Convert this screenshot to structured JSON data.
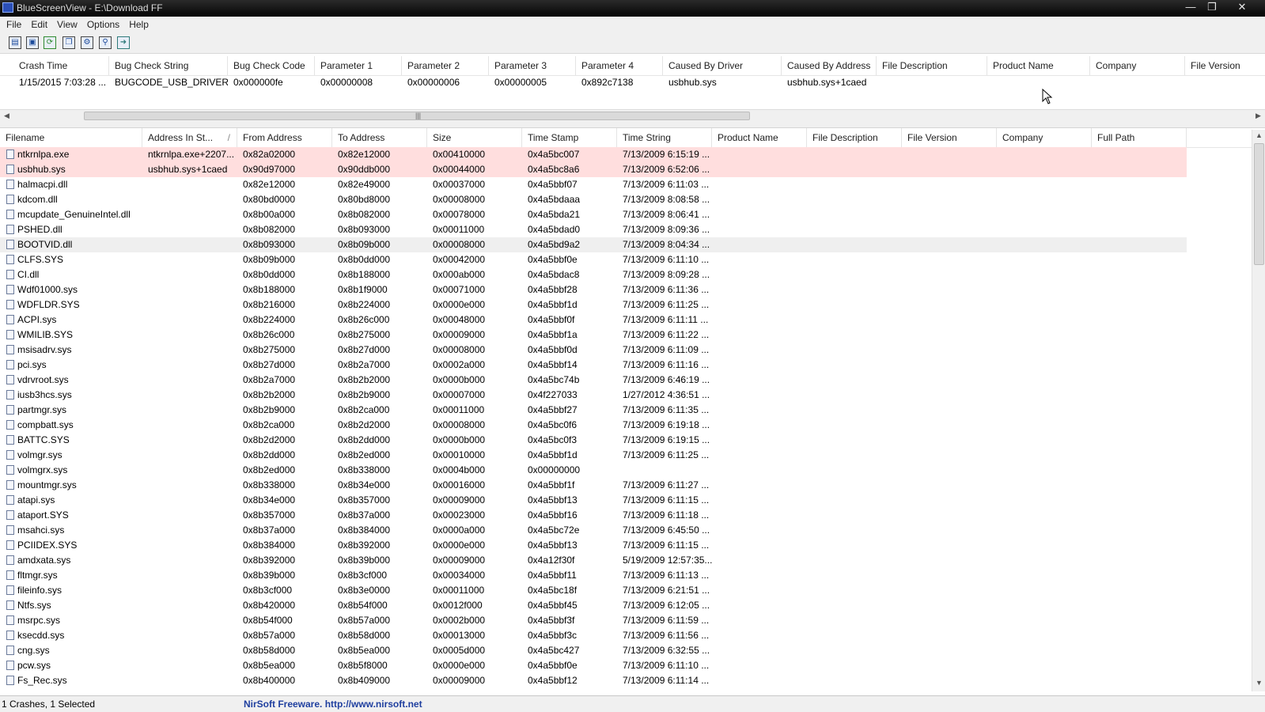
{
  "window": {
    "title": "BlueScreenView  -  E:\\Download FF"
  },
  "menu": [
    "File",
    "Edit",
    "View",
    "Options",
    "Help"
  ],
  "toolbar": [
    "properties-icon",
    "save-icon",
    "refresh-icon",
    "copy-icon",
    "advanced-options-icon",
    "find-icon",
    "exit-icon"
  ],
  "crashes": {
    "columns": [
      "Crash Time",
      "Bug Check String",
      "Bug Check Code",
      "Parameter 1",
      "Parameter 2",
      "Parameter 3",
      "Parameter 4",
      "Caused By Driver",
      "Caused By Address",
      "File Description",
      "Product Name",
      "Company",
      "File Version"
    ],
    "rows": [
      [
        "1/15/2015 7:03:28 ...",
        "BUGCODE_USB_DRIVER",
        "0x000000fe",
        "0x00000008",
        "0x00000006",
        "0x00000005",
        "0x892c7138",
        "usbhub.sys",
        "usbhub.sys+1caed",
        "",
        "",
        "",
        ""
      ]
    ]
  },
  "drivers": {
    "columns": [
      "Filename",
      "Address In St...",
      "From Address",
      "To Address",
      "Size",
      "Time Stamp",
      "Time String",
      "Product Name",
      "File Description",
      "File Version",
      "Company",
      "Full Path"
    ],
    "sort_indicator": "/",
    "rows": [
      [
        "ntkrnlpa.exe",
        "ntkrnlpa.exe+2207...",
        "0x82a02000",
        "0x82e12000",
        "0x00410000",
        "0x4a5bc007",
        "7/13/2009 6:15:19 ...",
        "",
        "",
        "",
        "",
        ""
      ],
      [
        "usbhub.sys",
        "usbhub.sys+1caed",
        "0x90d97000",
        "0x90ddb000",
        "0x00044000",
        "0x4a5bc8a6",
        "7/13/2009 6:52:06 ...",
        "",
        "",
        "",
        "",
        ""
      ],
      [
        "halmacpi.dll",
        "",
        "0x82e12000",
        "0x82e49000",
        "0x00037000",
        "0x4a5bbf07",
        "7/13/2009 6:11:03 ...",
        "",
        "",
        "",
        "",
        ""
      ],
      [
        "kdcom.dll",
        "",
        "0x80bd0000",
        "0x80bd8000",
        "0x00008000",
        "0x4a5bdaaa",
        "7/13/2009 8:08:58 ...",
        "",
        "",
        "",
        "",
        ""
      ],
      [
        "mcupdate_GenuineIntel.dll",
        "",
        "0x8b00a000",
        "0x8b082000",
        "0x00078000",
        "0x4a5bda21",
        "7/13/2009 8:06:41 ...",
        "",
        "",
        "",
        "",
        ""
      ],
      [
        "PSHED.dll",
        "",
        "0x8b082000",
        "0x8b093000",
        "0x00011000",
        "0x4a5bdad0",
        "7/13/2009 8:09:36 ...",
        "",
        "",
        "",
        "",
        ""
      ],
      [
        "BOOTVID.dll",
        "",
        "0x8b093000",
        "0x8b09b000",
        "0x00008000",
        "0x4a5bd9a2",
        "7/13/2009 8:04:34 ...",
        "",
        "",
        "",
        "",
        ""
      ],
      [
        "CLFS.SYS",
        "",
        "0x8b09b000",
        "0x8b0dd000",
        "0x00042000",
        "0x4a5bbf0e",
        "7/13/2009 6:11:10 ...",
        "",
        "",
        "",
        "",
        ""
      ],
      [
        "CI.dll",
        "",
        "0x8b0dd000",
        "0x8b188000",
        "0x000ab000",
        "0x4a5bdac8",
        "7/13/2009 8:09:28 ...",
        "",
        "",
        "",
        "",
        ""
      ],
      [
        "Wdf01000.sys",
        "",
        "0x8b188000",
        "0x8b1f9000",
        "0x00071000",
        "0x4a5bbf28",
        "7/13/2009 6:11:36 ...",
        "",
        "",
        "",
        "",
        ""
      ],
      [
        "WDFLDR.SYS",
        "",
        "0x8b216000",
        "0x8b224000",
        "0x0000e000",
        "0x4a5bbf1d",
        "7/13/2009 6:11:25 ...",
        "",
        "",
        "",
        "",
        ""
      ],
      [
        "ACPI.sys",
        "",
        "0x8b224000",
        "0x8b26c000",
        "0x00048000",
        "0x4a5bbf0f",
        "7/13/2009 6:11:11 ...",
        "",
        "",
        "",
        "",
        ""
      ],
      [
        "WMILIB.SYS",
        "",
        "0x8b26c000",
        "0x8b275000",
        "0x00009000",
        "0x4a5bbf1a",
        "7/13/2009 6:11:22 ...",
        "",
        "",
        "",
        "",
        ""
      ],
      [
        "msisadrv.sys",
        "",
        "0x8b275000",
        "0x8b27d000",
        "0x00008000",
        "0x4a5bbf0d",
        "7/13/2009 6:11:09 ...",
        "",
        "",
        "",
        "",
        ""
      ],
      [
        "pci.sys",
        "",
        "0x8b27d000",
        "0x8b2a7000",
        "0x0002a000",
        "0x4a5bbf14",
        "7/13/2009 6:11:16 ...",
        "",
        "",
        "",
        "",
        ""
      ],
      [
        "vdrvroot.sys",
        "",
        "0x8b2a7000",
        "0x8b2b2000",
        "0x0000b000",
        "0x4a5bc74b",
        "7/13/2009 6:46:19 ...",
        "",
        "",
        "",
        "",
        ""
      ],
      [
        "iusb3hcs.sys",
        "",
        "0x8b2b2000",
        "0x8b2b9000",
        "0x00007000",
        "0x4f227033",
        "1/27/2012 4:36:51 ...",
        "",
        "",
        "",
        "",
        ""
      ],
      [
        "partmgr.sys",
        "",
        "0x8b2b9000",
        "0x8b2ca000",
        "0x00011000",
        "0x4a5bbf27",
        "7/13/2009 6:11:35 ...",
        "",
        "",
        "",
        "",
        ""
      ],
      [
        "compbatt.sys",
        "",
        "0x8b2ca000",
        "0x8b2d2000",
        "0x00008000",
        "0x4a5bc0f6",
        "7/13/2009 6:19:18 ...",
        "",
        "",
        "",
        "",
        ""
      ],
      [
        "BATTC.SYS",
        "",
        "0x8b2d2000",
        "0x8b2dd000",
        "0x0000b000",
        "0x4a5bc0f3",
        "7/13/2009 6:19:15 ...",
        "",
        "",
        "",
        "",
        ""
      ],
      [
        "volmgr.sys",
        "",
        "0x8b2dd000",
        "0x8b2ed000",
        "0x00010000",
        "0x4a5bbf1d",
        "7/13/2009 6:11:25 ...",
        "",
        "",
        "",
        "",
        ""
      ],
      [
        "volmgrx.sys",
        "",
        "0x8b2ed000",
        "0x8b338000",
        "0x0004b000",
        "0x00000000",
        "",
        "",
        "",
        "",
        "",
        ""
      ],
      [
        "mountmgr.sys",
        "",
        "0x8b338000",
        "0x8b34e000",
        "0x00016000",
        "0x4a5bbf1f",
        "7/13/2009 6:11:27 ...",
        "",
        "",
        "",
        "",
        ""
      ],
      [
        "atapi.sys",
        "",
        "0x8b34e000",
        "0x8b357000",
        "0x00009000",
        "0x4a5bbf13",
        "7/13/2009 6:11:15 ...",
        "",
        "",
        "",
        "",
        ""
      ],
      [
        "ataport.SYS",
        "",
        "0x8b357000",
        "0x8b37a000",
        "0x00023000",
        "0x4a5bbf16",
        "7/13/2009 6:11:18 ...",
        "",
        "",
        "",
        "",
        ""
      ],
      [
        "msahci.sys",
        "",
        "0x8b37a000",
        "0x8b384000",
        "0x0000a000",
        "0x4a5bc72e",
        "7/13/2009 6:45:50 ...",
        "",
        "",
        "",
        "",
        ""
      ],
      [
        "PCIIDEX.SYS",
        "",
        "0x8b384000",
        "0x8b392000",
        "0x0000e000",
        "0x4a5bbf13",
        "7/13/2009 6:11:15 ...",
        "",
        "",
        "",
        "",
        ""
      ],
      [
        "amdxata.sys",
        "",
        "0x8b392000",
        "0x8b39b000",
        "0x00009000",
        "0x4a12f30f",
        "5/19/2009 12:57:35...",
        "",
        "",
        "",
        "",
        ""
      ],
      [
        "fltmgr.sys",
        "",
        "0x8b39b000",
        "0x8b3cf000",
        "0x00034000",
        "0x4a5bbf11",
        "7/13/2009 6:11:13 ...",
        "",
        "",
        "",
        "",
        ""
      ],
      [
        "fileinfo.sys",
        "",
        "0x8b3cf000",
        "0x8b3e0000",
        "0x00011000",
        "0x4a5bc18f",
        "7/13/2009 6:21:51 ...",
        "",
        "",
        "",
        "",
        ""
      ],
      [
        "Ntfs.sys",
        "",
        "0x8b420000",
        "0x8b54f000",
        "0x0012f000",
        "0x4a5bbf45",
        "7/13/2009 6:12:05 ...",
        "",
        "",
        "",
        "",
        ""
      ],
      [
        "msrpc.sys",
        "",
        "0x8b54f000",
        "0x8b57a000",
        "0x0002b000",
        "0x4a5bbf3f",
        "7/13/2009 6:11:59 ...",
        "",
        "",
        "",
        "",
        ""
      ],
      [
        "ksecdd.sys",
        "",
        "0x8b57a000",
        "0x8b58d000",
        "0x00013000",
        "0x4a5bbf3c",
        "7/13/2009 6:11:56 ...",
        "",
        "",
        "",
        "",
        ""
      ],
      [
        "cng.sys",
        "",
        "0x8b58d000",
        "0x8b5ea000",
        "0x0005d000",
        "0x4a5bc427",
        "7/13/2009 6:32:55 ...",
        "",
        "",
        "",
        "",
        ""
      ],
      [
        "pcw.sys",
        "",
        "0x8b5ea000",
        "0x8b5f8000",
        "0x0000e000",
        "0x4a5bbf0e",
        "7/13/2009 6:11:10 ...",
        "",
        "",
        "",
        "",
        ""
      ],
      [
        "Fs_Rec.sys",
        "",
        "0x8b400000",
        "0x8b409000",
        "0x00009000",
        "0x4a5bbf12",
        "7/13/2009 6:11:14 ...",
        "",
        "",
        "",
        "",
        ""
      ]
    ]
  },
  "status": {
    "summary": "1 Crashes, 1 Selected",
    "credit": "NirSoft Freeware.  http://www.nirsoft.net"
  },
  "colors": {
    "highlight_row": "#ffdede",
    "selected_row": "#efefef",
    "credit_text": "#1f3f9f"
  }
}
